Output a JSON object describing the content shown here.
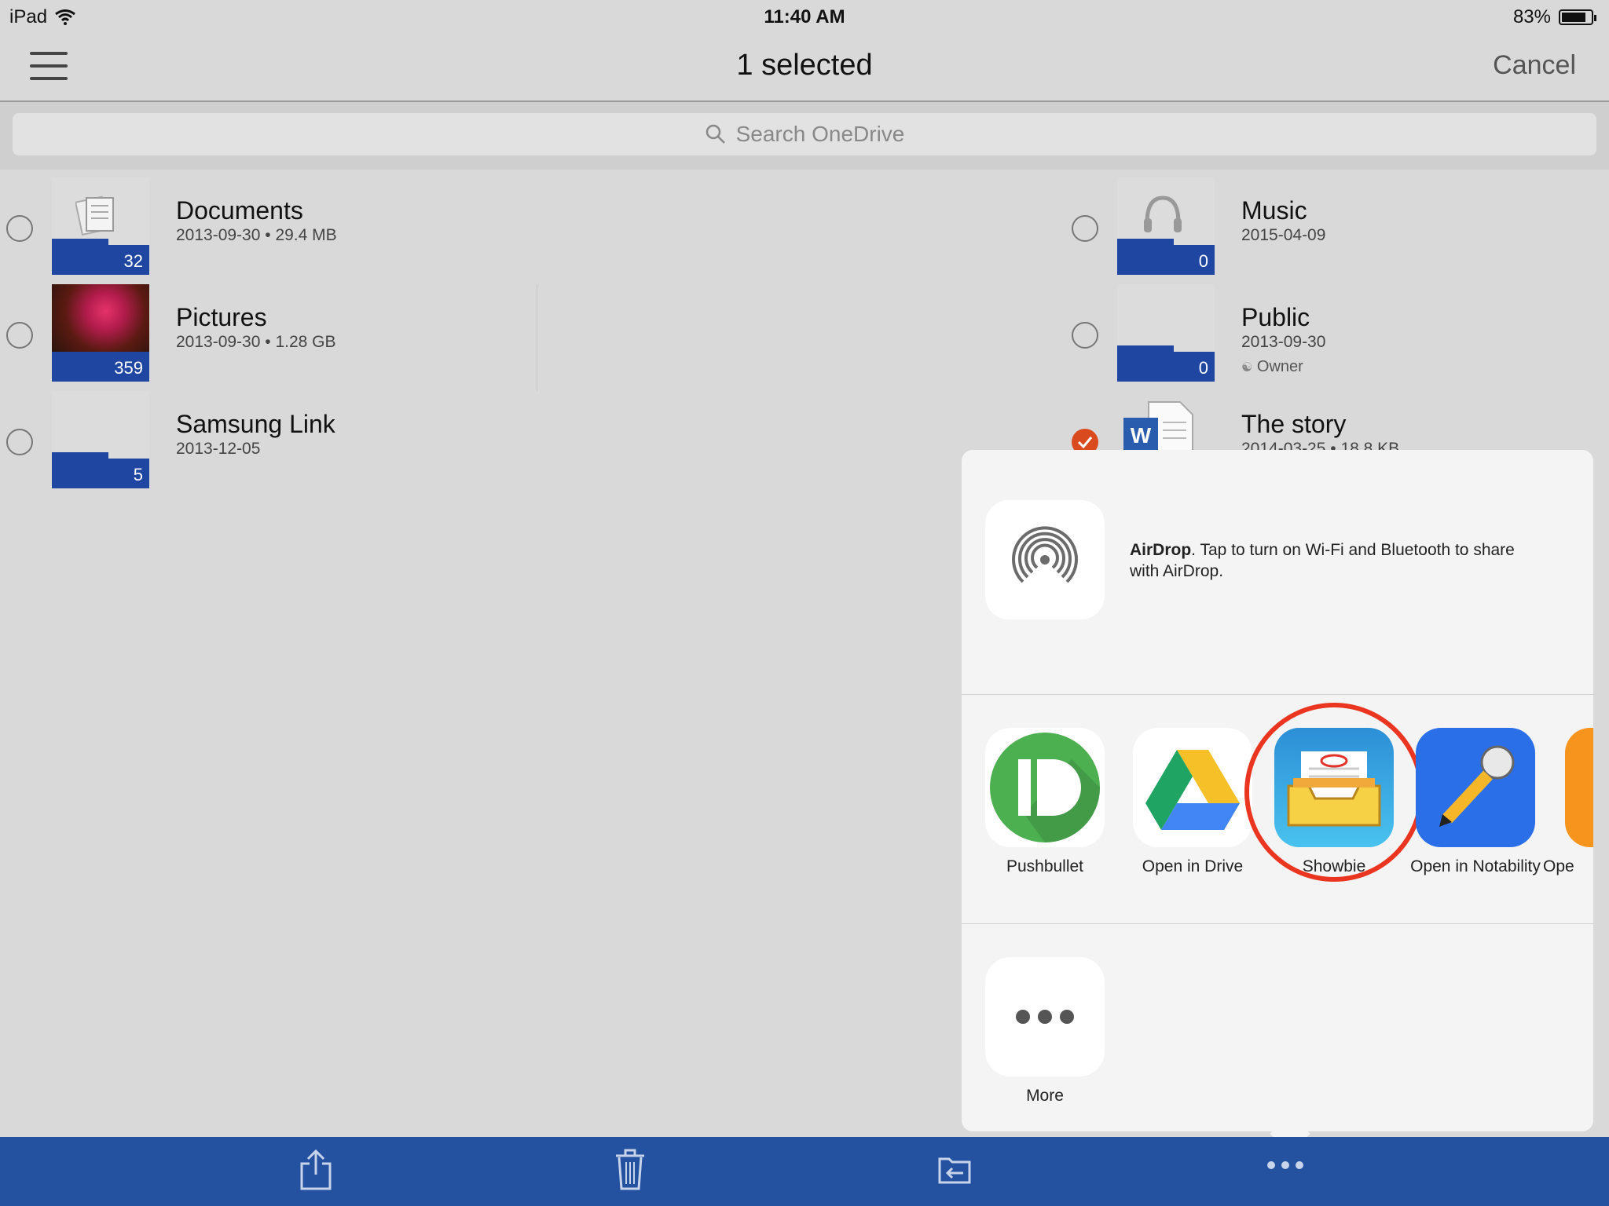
{
  "status": {
    "device": "iPad",
    "time": "11:40 AM",
    "battery": "83%"
  },
  "nav": {
    "title": "1 selected",
    "cancel": "Cancel"
  },
  "search": {
    "placeholder": "Search OneDrive"
  },
  "left_items": [
    {
      "name": "Documents",
      "meta": "2013-09-30 • 29.4 MB",
      "count": "32"
    },
    {
      "name": "Pictures",
      "meta": "2013-09-30 • 1.28 GB",
      "count": "359"
    },
    {
      "name": "Samsung Link",
      "meta": "2013-12-05",
      "count": "5"
    }
  ],
  "right_items": [
    {
      "name": "Music",
      "meta": "2015-04-09",
      "count": "0"
    },
    {
      "name": "Public",
      "meta": "2013-09-30",
      "owner": "Owner",
      "count": "0"
    },
    {
      "name": "The story",
      "meta": "2014-03-25 • 18.8 KB"
    }
  ],
  "share": {
    "airdrop_title": "AirDrop",
    "airdrop_text": ". Tap to turn on Wi-Fi and Bluetooth to share with AirDrop.",
    "apps": [
      {
        "label": "Pushbullet"
      },
      {
        "label": "Open in Drive"
      },
      {
        "label": "Showbie"
      },
      {
        "label": "Open in Notability"
      },
      {
        "label": "Ope"
      }
    ],
    "more_label": "More"
  },
  "colors": {
    "toolbar": "#2451a0",
    "folder_band": "#1f47a2",
    "highlight": "#ea3620",
    "selected": "#d94b1f"
  }
}
